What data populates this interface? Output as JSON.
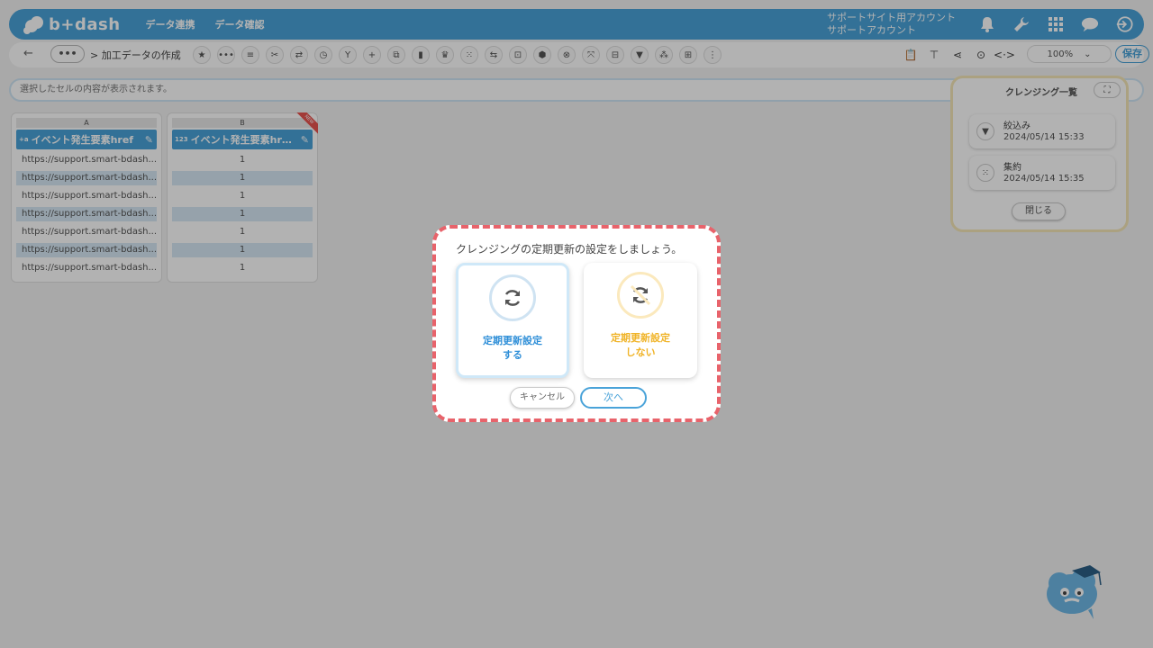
{
  "header": {
    "logo_text": "b+dash",
    "nav": [
      "データ連携",
      "データ確認"
    ],
    "account_line1": "サポートサイト用アカウント",
    "account_line2": "サポートアカウント",
    "icons": [
      "bell-icon",
      "wrench-icon",
      "grid-icon",
      "chat-icon",
      "logout-icon"
    ]
  },
  "toolbar": {
    "back_label": "←",
    "menu_label": "•••",
    "breadcrumb": "> 加工データの作成",
    "tools": [
      "★",
      "•••",
      "≡",
      "✂",
      "⇄",
      "◷",
      "Y",
      "+",
      "⧉",
      "▮",
      "♛",
      "⁙",
      "⇆",
      "⊡",
      "⬢",
      "⊗",
      "⤧",
      "⊟",
      "▼",
      "⁂",
      "⊞",
      "⋮"
    ],
    "right_tools": [
      "📋",
      "⊤",
      "⋖",
      "⊙",
      "<·>"
    ],
    "zoom_value": "100%",
    "zoom_arrow": "⌄",
    "save_label": "保存"
  },
  "cell_bar": {
    "placeholder": "選択したセルの内容が表示されます。"
  },
  "columns": [
    {
      "letter": "A",
      "type_icon": "+a",
      "header": "イベント発生要素href",
      "rows": [
        "https://support.smart-bdash...",
        "https://support.smart-bdash...",
        "https://support.smart-bdash...",
        "https://support.smart-bdash...",
        "https://support.smart-bdash...",
        "https://support.smart-bdash...",
        "https://support.smart-bdash..."
      ]
    },
    {
      "letter": "B",
      "type_icon": "123",
      "header": "イベント発生要素hr…",
      "badge": "NEW",
      "rows": [
        "1",
        "1",
        "1",
        "1",
        "1",
        "1",
        "1"
      ]
    }
  ],
  "cleansing_list": {
    "title": "クレンジング一覧",
    "expand_icon": "⛶",
    "items": [
      {
        "name": "絞込み",
        "date": "2024/05/14 15:33",
        "icon": "▼"
      },
      {
        "name": "集約",
        "date": "2024/05/14 15:35",
        "icon": "⁙"
      }
    ],
    "close_label": "閉じる"
  },
  "dialog": {
    "title": "クレンジングの定期更新の設定をしましょう。",
    "options": [
      {
        "line1": "定期更新設定",
        "line2": "する",
        "color": "#2f8fd8",
        "ring": "#cfe3f2"
      },
      {
        "line1": "定期更新設定",
        "line2": "しない",
        "color": "#f0b429",
        "ring": "#fbe9bd"
      }
    ],
    "cancel_label": "キャンセル",
    "next_label": "次へ"
  }
}
